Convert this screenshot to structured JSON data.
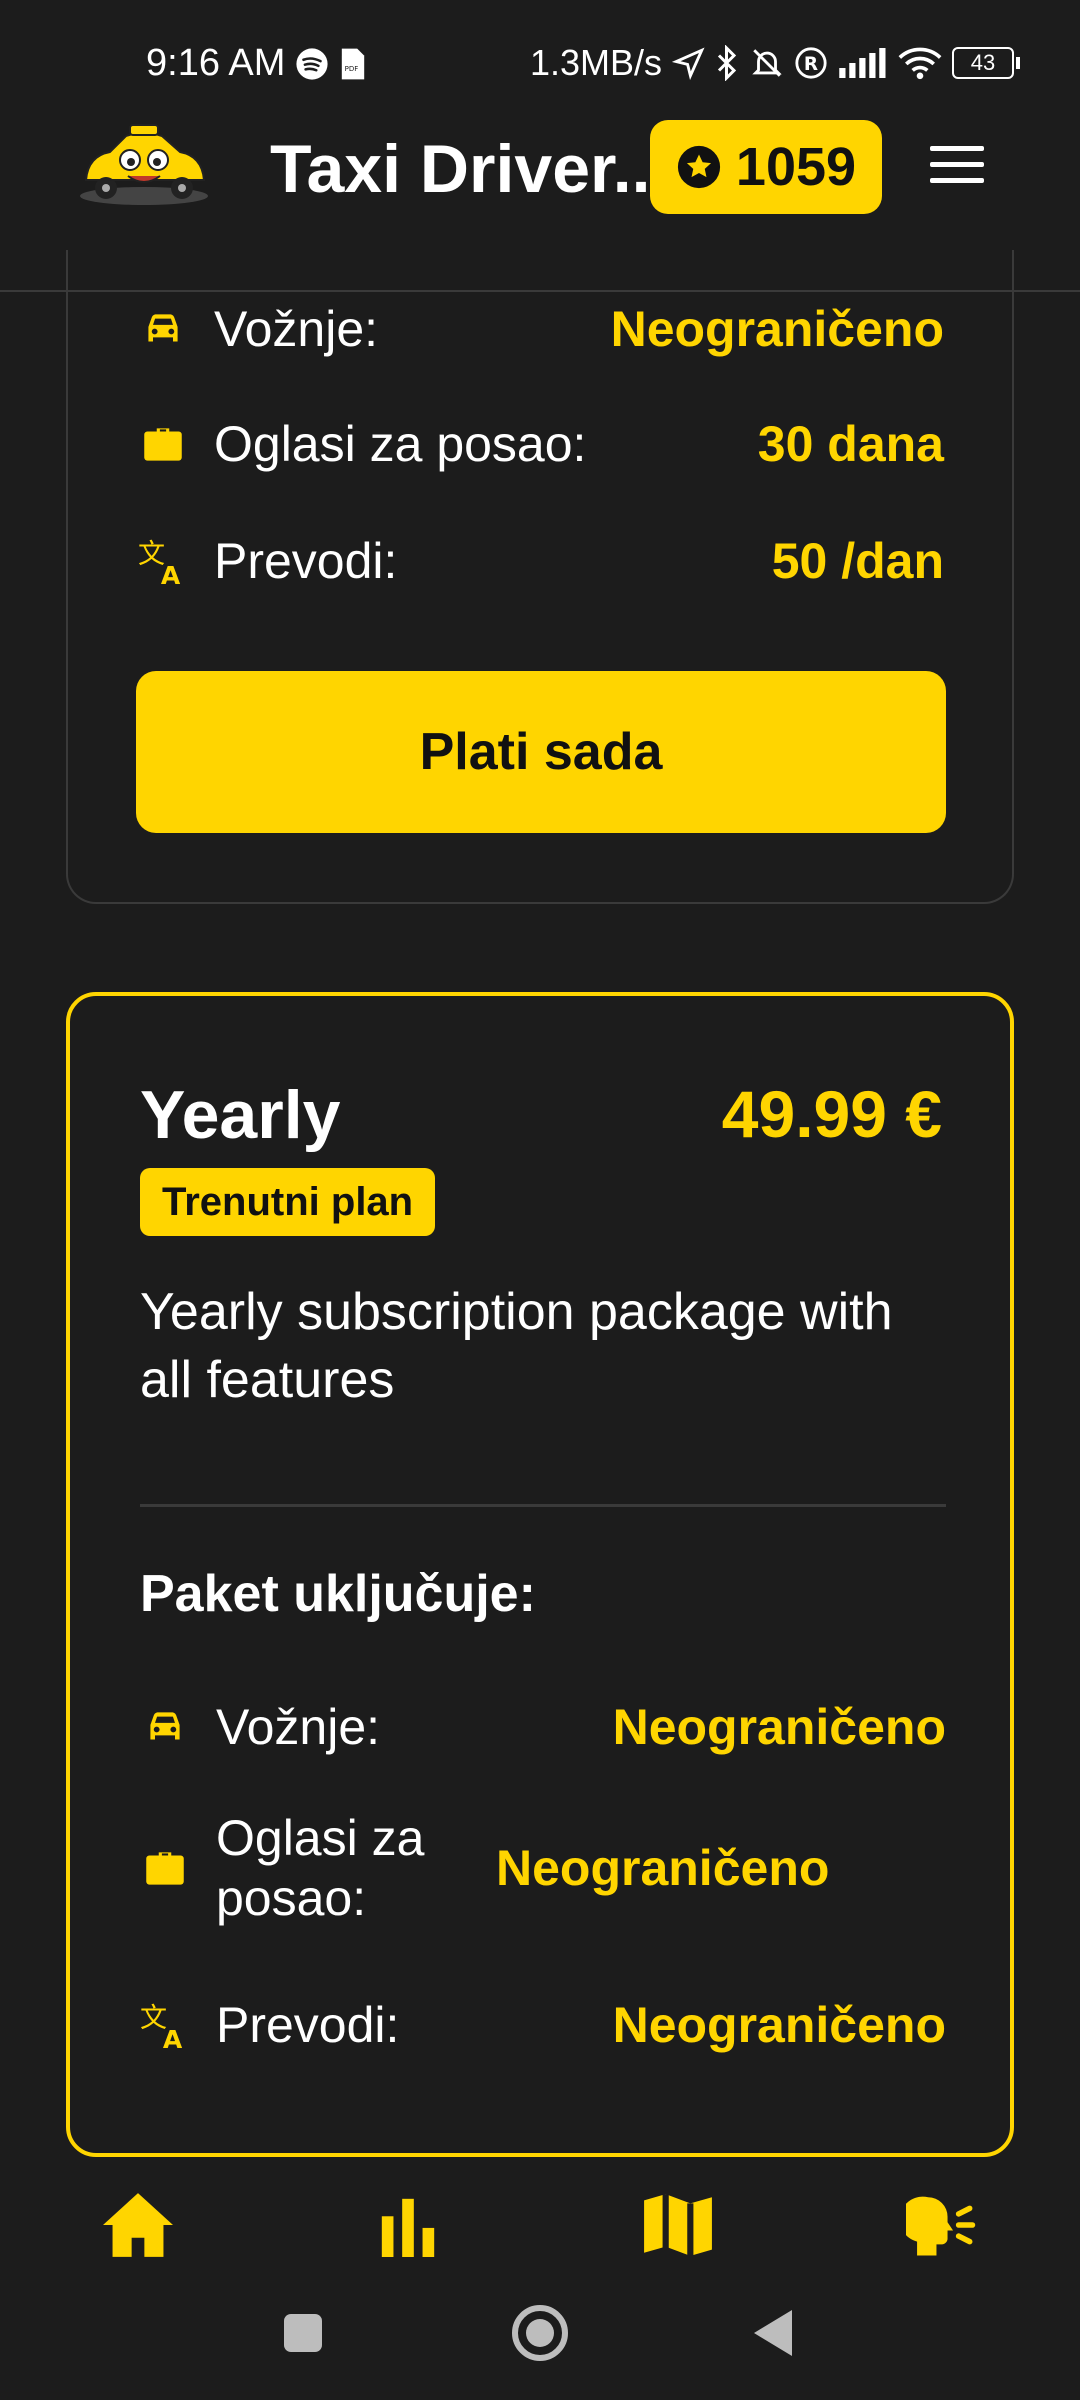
{
  "status_bar": {
    "time": "9:16 AM",
    "network_speed": "1.3MB/s",
    "battery": "43",
    "icons": [
      "spotify-icon",
      "pdf-icon",
      "location-icon",
      "bluetooth-icon",
      "mute-icon",
      "registered-icon",
      "signal-icon",
      "wifi-icon",
      "battery-icon"
    ]
  },
  "header": {
    "title": "Taxi Driver...",
    "points": "1059",
    "logo": "taxi-logo",
    "menu_icon": "hamburger-menu-icon"
  },
  "previous_plan": {
    "features": [
      {
        "icon": "car-icon",
        "label": "Vožnje:",
        "value": "Neograničeno"
      },
      {
        "icon": "briefcase-icon",
        "label": "Oglasi za posao:",
        "value": "30 dana"
      },
      {
        "icon": "translate-icon",
        "label": "Prevodi:",
        "value": "50 /dan"
      }
    ],
    "pay_button": "Plati sada"
  },
  "yearly_plan": {
    "name": "Yearly",
    "price": "49.99 €",
    "badge": "Trenutni plan",
    "description": "Yearly subscription package with all features",
    "includes_heading": "Paket uključuje:",
    "features": [
      {
        "icon": "car-icon",
        "label": "Vožnje:",
        "value": "Neograničeno"
      },
      {
        "icon": "briefcase-icon",
        "label": "Oglasi za posao:",
        "value": "Neograničeno"
      },
      {
        "icon": "translate-icon",
        "label": "Prevodi:",
        "value": "Neograničeno"
      }
    ]
  },
  "bottom_nav": [
    "home-icon",
    "stats-icon",
    "map-icon",
    "voice-icon"
  ],
  "system_nav": [
    "recents-button",
    "home-button",
    "back-button"
  ],
  "colors": {
    "accent": "#ffd500",
    "background": "#1c1c1c",
    "border": "#3a3a3a"
  }
}
